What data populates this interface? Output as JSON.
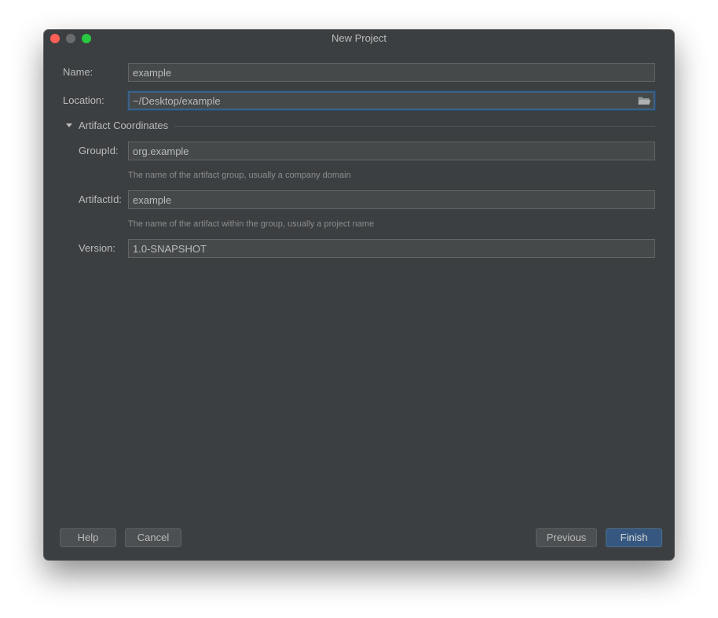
{
  "window": {
    "title": "New Project"
  },
  "form": {
    "name": {
      "label": "Name:",
      "value": "example"
    },
    "location": {
      "label": "Location:",
      "value": "~/Desktop/example"
    },
    "artifact_section": {
      "label": "Artifact Coordinates"
    },
    "group_id": {
      "label": "GroupId:",
      "value": "org.example",
      "hint": "The name of the artifact group, usually a company domain"
    },
    "artifact_id": {
      "label": "ArtifactId:",
      "value": "example",
      "hint": "The name of the artifact within the group, usually a project name"
    },
    "version": {
      "label": "Version:",
      "value": "1.0-SNAPSHOT"
    }
  },
  "buttons": {
    "help": "Help",
    "cancel": "Cancel",
    "previous": "Previous",
    "finish": "Finish"
  },
  "colors": {
    "background": "#3c3f41",
    "field_bg": "#45494a",
    "focus": "#3d6185",
    "primary_button": "#365880",
    "close": "#fe5f57",
    "minimize": "#696b6d",
    "maximize": "#2ac840"
  },
  "icons": {
    "location_browse": "folder-icon",
    "section_toggle": "triangle-down-icon"
  }
}
